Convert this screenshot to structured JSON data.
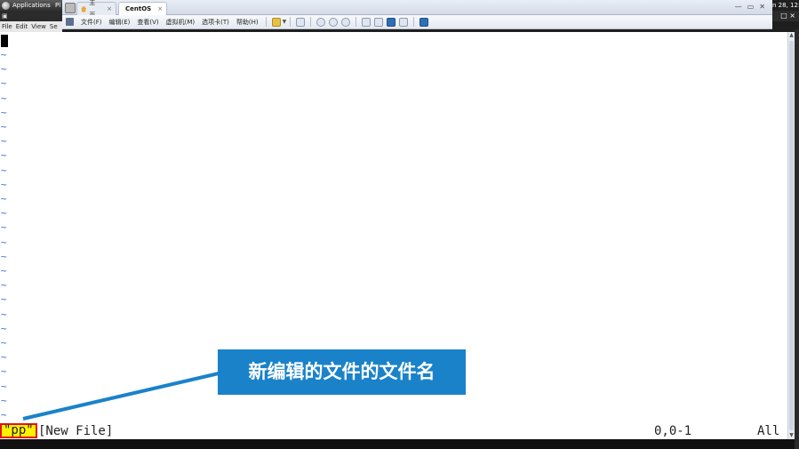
{
  "guest_panel": {
    "applications": "Applications",
    "places": "Pl",
    "clock": "n 28, 12:"
  },
  "terminal": {
    "title_icon": "terminal-icon",
    "menu": [
      "File",
      "Edit",
      "View",
      "Se"
    ]
  },
  "vmware": {
    "tabs": [
      {
        "label": "主页",
        "icon": "home-icon"
      },
      {
        "label": "CentOS",
        "icon": "vm-running-icon"
      }
    ],
    "tab_close": "×",
    "window_controls": [
      "—",
      "▭",
      "✕"
    ],
    "menu": [
      "文件(F)",
      "编辑(E)",
      "查看(V)",
      "虚拟机(M)",
      "选项卡(T)",
      "帮助(H)"
    ],
    "toolbar_icons": [
      "pause-icon",
      "send-ctrl-alt-del-icon",
      "snapshot-icon",
      "revert-snapshot-icon",
      "manage-snapshots-icon",
      "sidebar-icon",
      "thumbnail-bar-icon",
      "fullscreen-icon",
      "unity-icon",
      "console-view-icon"
    ],
    "guest_strip": "□ ×"
  },
  "vim": {
    "tilde": "~",
    "tilde_count": 27,
    "file_name": "\"pp\"",
    "file_status": "[New File]",
    "cursor_position": "0,0-1",
    "scroll_position": "All"
  },
  "annotation": {
    "text": "新编辑的文件的文件名",
    "color": "#1a82c9",
    "highlight_fill": "#fff200",
    "highlight_border": "#e8101a"
  },
  "colors": {
    "tilde": "#3a66d6"
  }
}
